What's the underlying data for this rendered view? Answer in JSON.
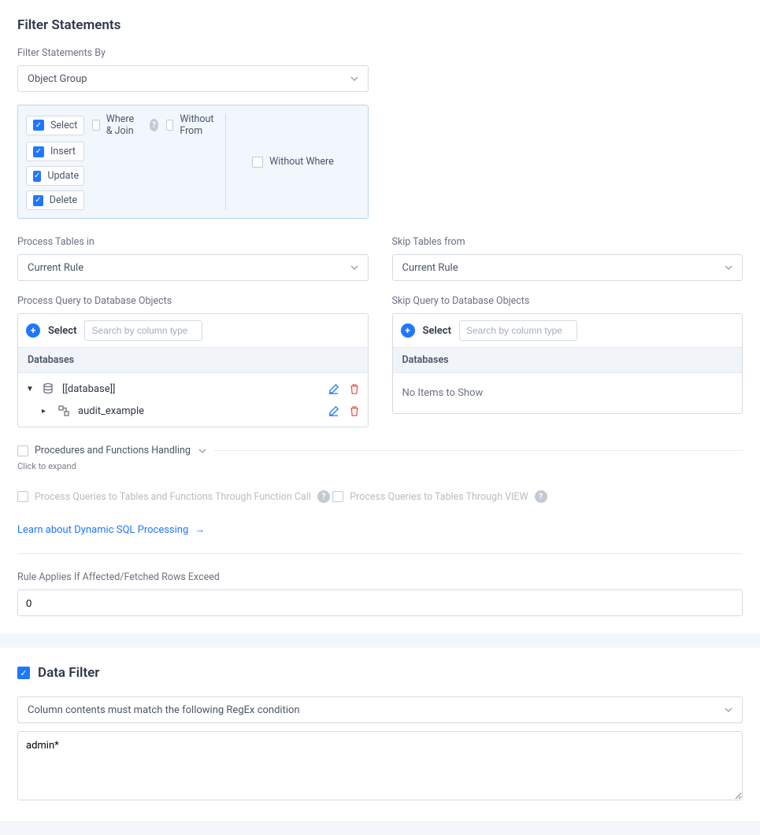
{
  "filter_statements": {
    "title": "Filter Statements",
    "by_label": "Filter Statements By",
    "by_value": "Object Group",
    "select": {
      "label": "Select",
      "checked": true
    },
    "where_join": {
      "label": "Where & Join",
      "checked": false
    },
    "without_from": {
      "label": "Without From",
      "checked": false
    },
    "insert": {
      "label": "Insert",
      "checked": true
    },
    "update": {
      "label": "Update",
      "checked": true
    },
    "delete": {
      "label": "Delete",
      "checked": true
    },
    "without_where": {
      "label": "Without Where",
      "checked": false
    }
  },
  "process_tables": {
    "label": "Process Tables in",
    "value": "Current Rule"
  },
  "skip_tables": {
    "label": "Skip Tables from",
    "value": "Current Rule"
  },
  "process_query": {
    "label": "Process Query to Database Objects",
    "select_label": "Select",
    "search_placeholder": "Search by column type",
    "header": "Databases",
    "items": [
      {
        "name": "[[database]]"
      },
      {
        "name": "audit_example"
      }
    ]
  },
  "skip_query": {
    "label": "Skip Query to Database Objects",
    "select_label": "Select",
    "search_placeholder": "Search by column type",
    "header": "Databases",
    "empty": "No Items to Show"
  },
  "procedures": {
    "title": "Procedures and Functions Handling",
    "click_expand": "Click to expand",
    "opt1": "Process Queries to Tables and Functions Through Function Call",
    "opt2": "Process Queries to Tables Through VIEW",
    "learn_link": "Learn about Dynamic SQL Processing"
  },
  "rule_applies": {
    "label": "Rule Applies If Affected/Fetched Rows Exceed",
    "value": "0"
  },
  "data_filter": {
    "title": "Data Filter",
    "checked": true,
    "condition": "Column contents must match the following RegEx condition",
    "regex": "admin*"
  }
}
